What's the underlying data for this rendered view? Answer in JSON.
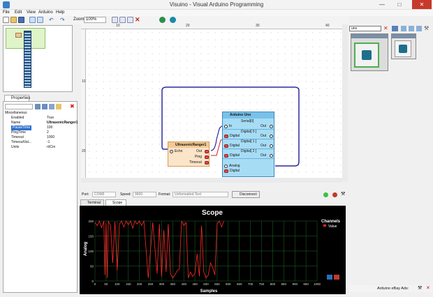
{
  "window": {
    "title": "Visuino - Visual Arduino Programming"
  },
  "menu": [
    "File",
    "Edit",
    "View",
    "Arduino",
    "Help"
  ],
  "toolbar": {
    "zoom_label": "Zoom:",
    "zoom_value": "100%"
  },
  "ruler": {
    "top_marks": [
      "10",
      "20",
      "30",
      "40"
    ],
    "left_marks": [
      "10",
      "20"
    ]
  },
  "properties": {
    "tab_label": "Properties",
    "rows": [
      {
        "key": "Miscellaneous",
        "value": "",
        "group": true
      },
      {
        "key": "Enabled",
        "value": "True"
      },
      {
        "key": "Name",
        "value": "UltrasonicRanger1"
      },
      {
        "key": "PauseTime",
        "value": "100",
        "selected": true
      },
      {
        "key": "PingTime",
        "value": "2"
      },
      {
        "key": "Timeout",
        "value": "1000"
      },
      {
        "key": "TimeoutVal...",
        "value": "-1"
      },
      {
        "key": "Units",
        "value": "rdCm"
      }
    ]
  },
  "diagram": {
    "sensor": {
      "title": "UltrasonicRanger1",
      "echo": "Echo",
      "out": "Out",
      "ping": "Ping",
      "timeout": "Timeout"
    },
    "arduino": {
      "title": "Arduino Uno",
      "serial": "Serial[0]",
      "in": "In",
      "out": "Out",
      "digital_rows": [
        {
          "header": "Digital[ 0 ]",
          "label": "Digital"
        },
        {
          "header": "Digital[ 1 ]",
          "label": "Digital"
        },
        {
          "header": "Digital[ 2 ]",
          "label": "Digital"
        }
      ],
      "analog": "Analog",
      "analog_digital": "Digital"
    }
  },
  "palette": {
    "search_value": "uno"
  },
  "serial": {
    "port_label": "Port:",
    "port_value": "COM5",
    "speed_label": "Speed:",
    "speed_value": "9600",
    "format_label": "Format:",
    "format_value": "Unformatted Text",
    "disconnect_label": "Disconnect"
  },
  "bottom_tabs": [
    "Terminal",
    "Scope"
  ],
  "scope": {
    "title": "Scope",
    "ylabel": "Analog",
    "xlabel": "Samples",
    "legend_title": "Channels",
    "legend_entry": "Value",
    "yticks": [
      "200",
      "150",
      "100",
      "50",
      "0"
    ],
    "xticks": [
      "0",
      "50",
      "100",
      "150",
      "200",
      "250",
      "300",
      "350",
      "400",
      "450",
      "500",
      "550",
      "600",
      "650",
      "700",
      "750",
      "800",
      "850",
      "900",
      "950",
      "1000"
    ],
    "trace_color": "#ff2a2a",
    "grid_color": "#1f6b2a"
  },
  "chart_data": {
    "type": "line",
    "title": "Scope",
    "xlabel": "Samples",
    "ylabel": "Analog",
    "xlim": [
      0,
      1000
    ],
    "ylim": [
      0,
      200
    ],
    "series": [
      {
        "name": "Value",
        "x": [
          0,
          10,
          20,
          30,
          40,
          45,
          50,
          55,
          60,
          70,
          80,
          90,
          100,
          110,
          120,
          130,
          140,
          150,
          160,
          170,
          180,
          190,
          200,
          210,
          220,
          240,
          260,
          280,
          290,
          300,
          310,
          320,
          330,
          340,
          350,
          360,
          370,
          380,
          390,
          400,
          410,
          420,
          430,
          440,
          450,
          460,
          470,
          480,
          490,
          500,
          510,
          520,
          530,
          540,
          550,
          560,
          570,
          580
        ],
        "y": [
          195,
          185,
          200,
          178,
          200,
          20,
          192,
          10,
          200,
          185,
          60,
          198,
          35,
          190,
          200,
          180,
          200,
          188,
          200,
          176,
          200,
          190,
          200,
          185,
          200,
          10,
          195,
          25,
          190,
          15,
          170,
          30,
          190,
          25,
          10,
          20,
          35,
          40,
          200,
          185,
          195,
          10,
          30,
          15,
          25,
          90,
          15,
          185,
          30,
          10,
          20,
          60,
          45,
          20,
          190,
          200,
          180,
          200
        ]
      }
    ]
  },
  "ads": {
    "label": "Arduino eBay Ads:"
  }
}
